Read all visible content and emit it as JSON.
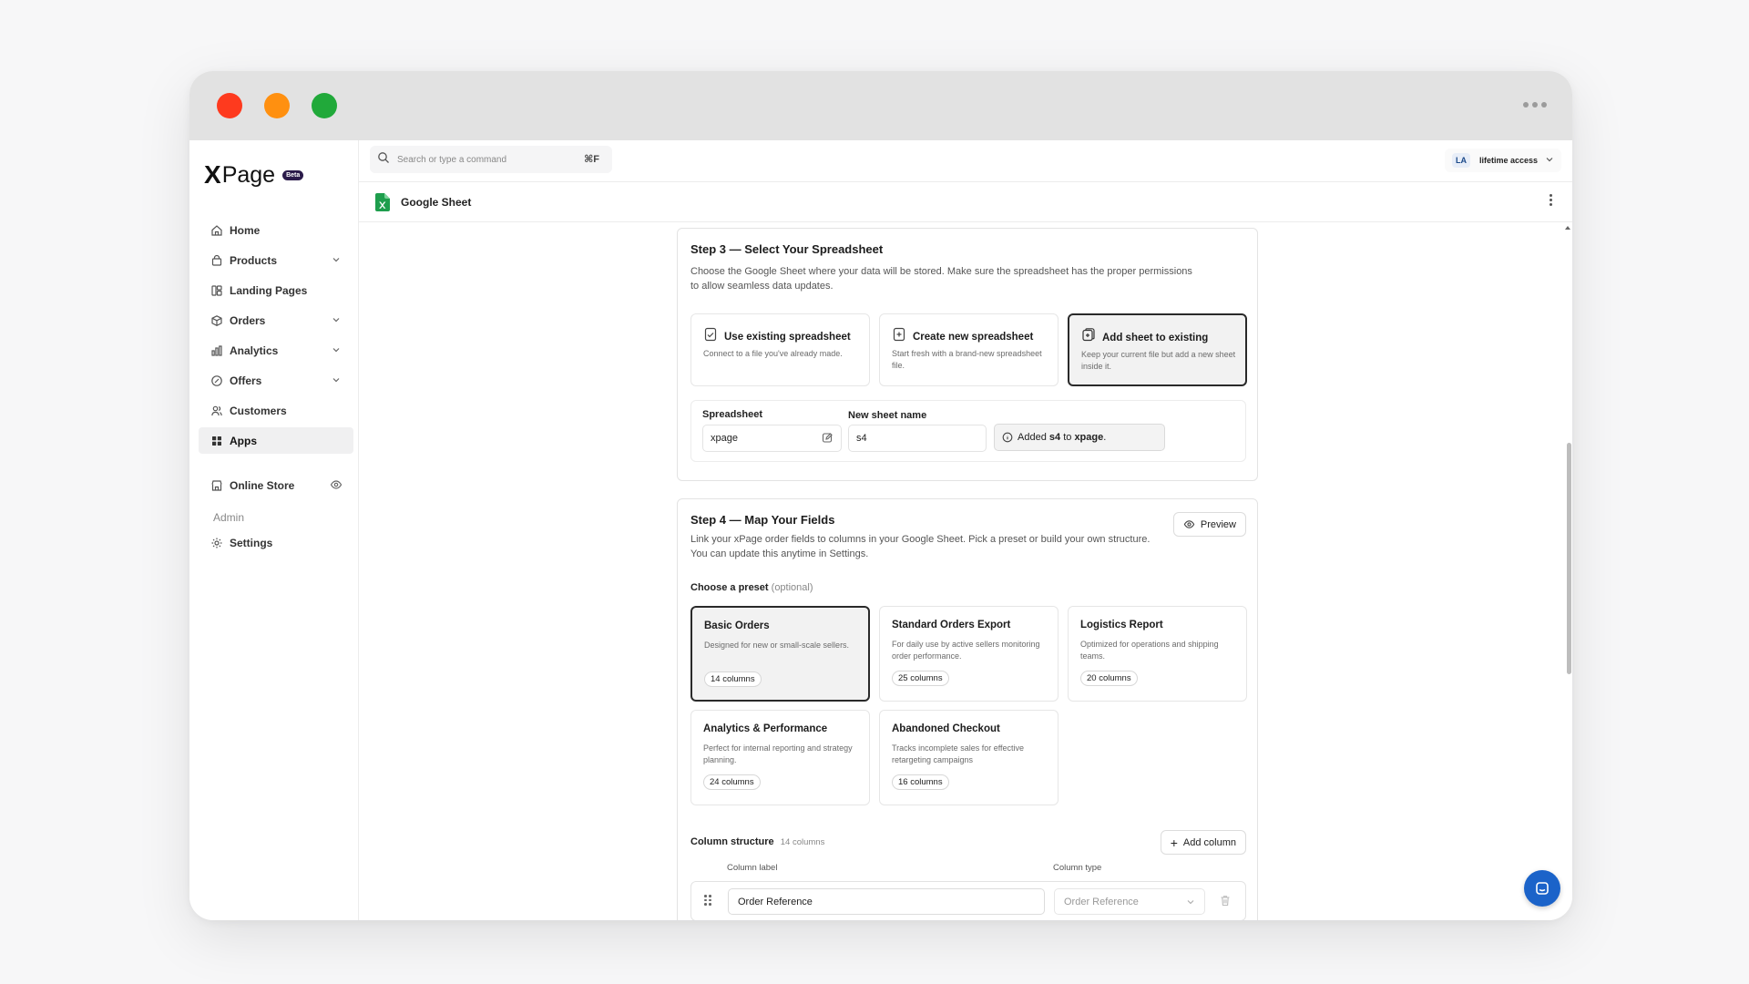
{
  "window": {
    "controls": [
      "close",
      "minimize",
      "maximize"
    ],
    "menu_icon": "more-horizontal-icon"
  },
  "brand": {
    "logo_mark": "X",
    "logo_text": "Page",
    "badge": "Beta"
  },
  "sidebar": {
    "items": [
      {
        "label": "Home",
        "icon": "home-icon"
      },
      {
        "label": "Products",
        "icon": "bag-icon",
        "expandable": true
      },
      {
        "label": "Landing Pages",
        "icon": "layout-icon"
      },
      {
        "label": "Orders",
        "icon": "box-icon",
        "expandable": true
      },
      {
        "label": "Analytics",
        "icon": "bar-chart-icon",
        "expandable": true
      },
      {
        "label": "Offers",
        "icon": "percent-icon",
        "expandable": true
      },
      {
        "label": "Customers",
        "icon": "users-icon"
      },
      {
        "label": "Apps",
        "icon": "grid-icon",
        "active": true
      }
    ],
    "store": {
      "label": "Online Store",
      "icon": "store-icon"
    },
    "admin_section": "Admin",
    "settings": {
      "label": "Settings",
      "icon": "gear-icon"
    }
  },
  "topbar": {
    "search_placeholder": "Search or type a command",
    "shortcut": "⌘F",
    "account_initials": "LA",
    "account_label": "lifetime access"
  },
  "app_header": {
    "title": "Google Sheet",
    "icon": "google-sheets-icon"
  },
  "step3": {
    "title": "Step 3 — Select Your Spreadsheet",
    "description": "Choose the Google Sheet where your data will be stored. Make sure the spreadsheet has the proper permissions to allow seamless data updates.",
    "options": [
      {
        "title": "Use existing spreadsheet",
        "description": "Connect to a file you've already made.",
        "icon": "file-check-icon"
      },
      {
        "title": "Create new spreadsheet",
        "description": "Start fresh with a brand-new spreadsheet file.",
        "icon": "file-plus-icon"
      },
      {
        "title": "Add sheet to existing",
        "description": "Keep your current file but add a new sheet inside it.",
        "icon": "files-icon",
        "selected": true
      }
    ],
    "spreadsheet_label": "Spreadsheet",
    "spreadsheet_value": "xpage",
    "sheet_name_label": "New sheet name",
    "sheet_name_value": "s4",
    "note_prefix": "Added",
    "note_sheet": "s4",
    "note_mid": "to",
    "note_file": "xpage",
    "note_suffix": "."
  },
  "step4": {
    "title": "Step 4 — Map Your Fields",
    "description": "Link your xPage order fields to columns in your Google Sheet. Pick a preset or build your own structure. You can update this anytime in Settings.",
    "preview_label": "Preview",
    "preset_label": "Choose a preset",
    "preset_optional": "(optional)",
    "presets": [
      {
        "title": "Basic Orders",
        "description": "Designed for new or small-scale sellers.",
        "badge": "14 columns",
        "selected": true
      },
      {
        "title": "Standard Orders Export",
        "description": "For daily use by active sellers monitoring order performance.",
        "badge": "25 columns"
      },
      {
        "title": "Logistics Report",
        "description": "Optimized for operations and shipping teams.",
        "badge": "20 columns"
      },
      {
        "title": "Analytics & Performance",
        "description": "Perfect for internal reporting and strategy planning.",
        "badge": "24 columns"
      },
      {
        "title": "Abandoned Checkout",
        "description": "Tracks incomplete sales for effective retargeting campaigns",
        "badge": "16 columns"
      }
    ],
    "column_structure_label": "Column structure",
    "column_structure_count": "14 columns",
    "add_column_label": "Add column",
    "col_label_header": "Column label",
    "col_type_header": "Column type",
    "rows": [
      {
        "label": "Order Reference",
        "type": "Order Reference"
      }
    ]
  },
  "chat": {
    "icon": "chat-icon"
  }
}
